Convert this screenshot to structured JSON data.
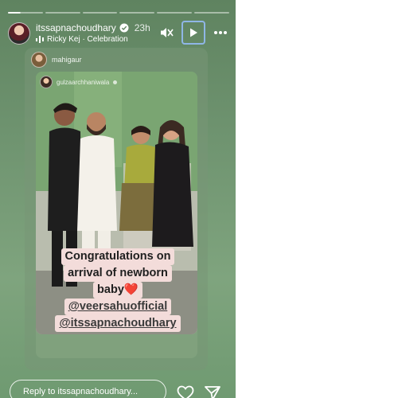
{
  "header": {
    "username": "itssapnachoudhary",
    "time": "23h",
    "music": "Ricky Kej · Celebration"
  },
  "repost1": {
    "username": "mahigaur"
  },
  "repost2": {
    "username": "gulzaarchhaniwala"
  },
  "sticker": {
    "line1": "Congratulations on",
    "line2": "arrival of newborn",
    "line3": "baby❤️",
    "mention1": "@veersahuofficial",
    "mention2": "@itssapnachoudhary"
  },
  "footer": {
    "reply_placeholder": "Reply to itssapnachoudhary..."
  },
  "colors": {
    "background": "#6f9470",
    "sticker_bg": "#f3dcda",
    "play_outline": "#8fb6e6"
  },
  "icons": {
    "verified": "verified-badge-icon",
    "music": "music-bars-icon",
    "mute": "speaker-muted-icon",
    "play": "play-icon",
    "more": "more-dots-icon",
    "like": "heart-icon",
    "share": "paper-plane-icon"
  }
}
